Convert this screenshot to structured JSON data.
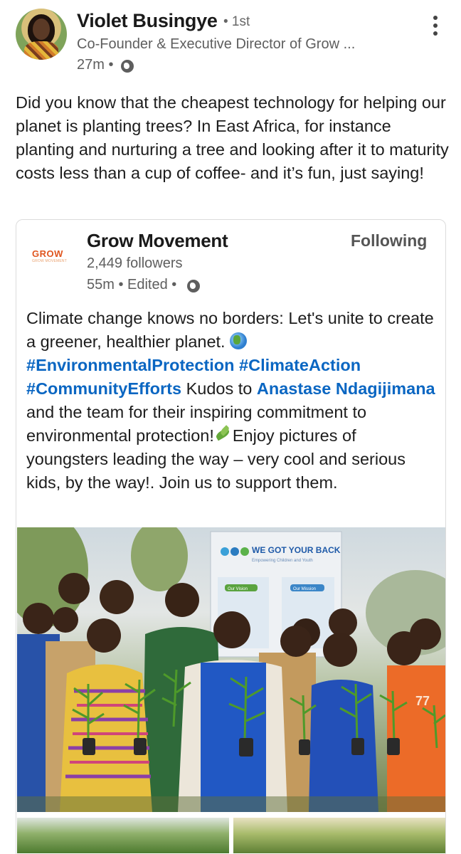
{
  "author": {
    "name": "Violet Busingye",
    "degree": "• 1st",
    "headline": "Co-Founder & Executive Director of Grow ...",
    "time": "27m •"
  },
  "post": {
    "text": "Did you know that the cheapest technology for helping our planet is planting trees?  In East Africa, for instance planting and nurturing a tree and looking after it to maturity costs less than a cup of coffee- and it’s fun, just saying!"
  },
  "reshare": {
    "logo_text": "GROW",
    "logo_sub": "GROW MOVEMENT",
    "company_name": "Grow Movement",
    "followers": "2,449 followers",
    "time": "55m • Edited •",
    "follow_label": "Following",
    "text_1": "Climate change knows no borders: Let's unite to create a greener, healthier planet.",
    "hashtag_1": "#EnvironmentalProtection",
    "hashtag_2": "#ClimateAction",
    "hashtag_3": "#CommunityEfforts",
    "text_2": " Kudos to ",
    "mention": "Anastase Ndagijimana",
    "text_3": " and the team for their inspiring commitment to environmental protection!",
    "text_4": "Enjoy pictures of youngsters leading the way – very cool and serious kids, by the way!. Join us to support them."
  },
  "photo": {
    "banner_title": "WE GOT YOUR BACK",
    "banner_subtitle": "Empowering Children and Youth",
    "banner_vision": "Our Vision",
    "banner_mission": "Our Mission",
    "shirt_text": "77"
  },
  "colors": {
    "link": "#0a66c2",
    "muted": "#5e5e5e",
    "logo_orange": "#e0561f"
  },
  "icons": [
    "more-icon",
    "globe-icon",
    "earth-emoji",
    "herb-emoji"
  ]
}
